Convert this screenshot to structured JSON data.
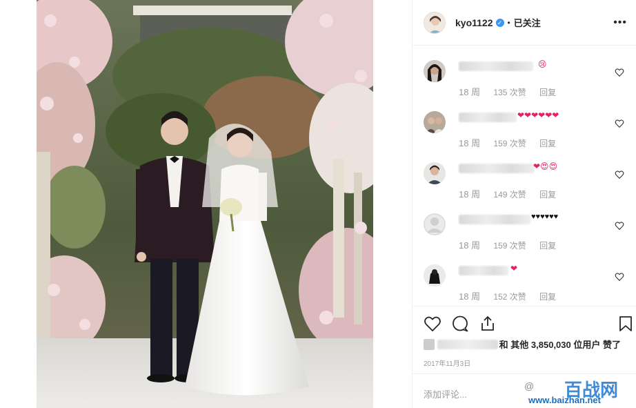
{
  "post": {
    "username": "kyo1122",
    "verified_glyph": "✓",
    "separator": "•",
    "follow_status": "已关注",
    "more_menu": "•••",
    "likes_prefix": "和",
    "likes_others": "其他",
    "likes_count": "3,850,030",
    "likes_unit": "位用户",
    "likes_suffix": "赞了",
    "date": "2017年11月3日",
    "comment_placeholder": "添加评论..."
  },
  "comments": [
    {
      "emoji": "😢",
      "age": "18 周",
      "likes": "135 次赞",
      "reply": "回复"
    },
    {
      "emoji": "❤❤❤❤❤❤",
      "age": "18 周",
      "likes": "159 次赞",
      "reply": "回复"
    },
    {
      "emoji": "❤😍😍",
      "age": "18 周",
      "likes": "149 次赞",
      "reply": "回复"
    },
    {
      "emoji": "♥♥♥♥♥♥",
      "age": "18 周",
      "likes": "159 次赞",
      "reply": "回复"
    },
    {
      "emoji": "❤",
      "age": "18 周",
      "likes": "152 次赞",
      "reply": "回复"
    }
  ],
  "watermark": {
    "weibo": "@",
    "brand": "百战网",
    "url": "www.baizhan.net"
  },
  "colors": {
    "verified": "#3897f0",
    "heart": "#e0245e",
    "meta_gray": "#999999",
    "border": "#efefef"
  },
  "icons": [
    "heart-icon",
    "comment-icon",
    "share-icon",
    "bookmark-icon",
    "more-icon",
    "verified-icon"
  ]
}
